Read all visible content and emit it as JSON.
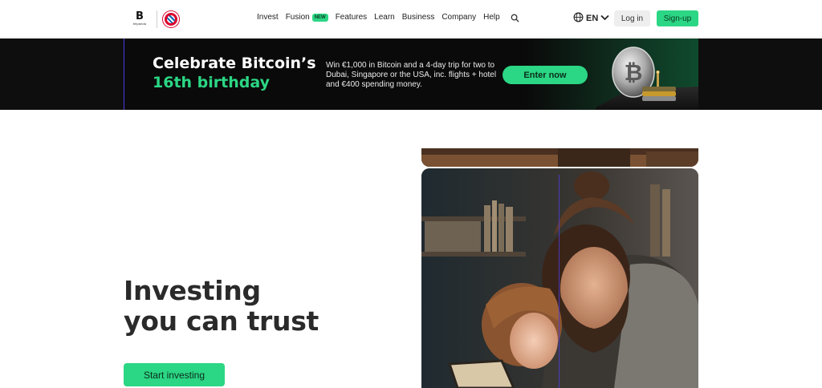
{
  "header": {
    "logo_word": "bitpanda",
    "nav": {
      "invest": "Invest",
      "fusion": "Fusion",
      "fusion_badge": "NEW",
      "features": "Features",
      "learn": "Learn",
      "business": "Business",
      "company": "Company",
      "help": "Help"
    },
    "language": "EN",
    "login_label": "Log in",
    "signup_label": "Sign-up"
  },
  "promo": {
    "title_line1": "Celebrate Bitcoin’s",
    "title_line2": "16th birthday",
    "text": "Win €1,000 in Bitcoin and a 4-day trip for two to Dubai, Singapore or the USA, inc. flights + hotel and €400 spending money.",
    "cta_label": "Enter now"
  },
  "hero": {
    "title_line1": "Investing",
    "title_line2": "you can trust",
    "cta_label": "Start investing"
  },
  "colors": {
    "accent_green": "#2bd684",
    "banner_bg": "#0e0e0e",
    "text_dark": "#2a2a2a"
  },
  "icons": {
    "search": "search-icon",
    "globe": "globe-icon",
    "chevron": "chevron-down-icon",
    "bitcoin": "bitcoin-coin-icon"
  }
}
